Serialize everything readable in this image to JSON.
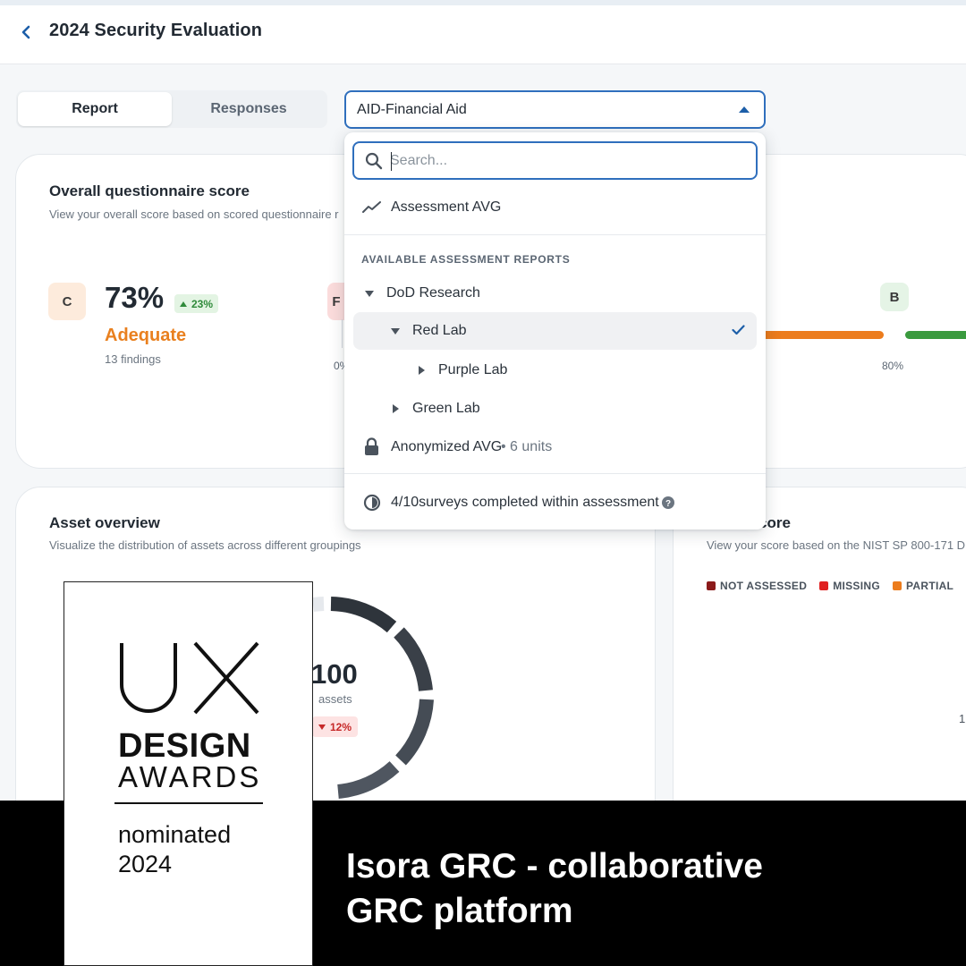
{
  "header": {
    "title": "2024 Security Evaluation",
    "back_icon": "chevron-left-icon"
  },
  "tabs": [
    {
      "label": "Report",
      "active": true
    },
    {
      "label": "Responses",
      "active": false
    }
  ],
  "report_select": {
    "value": "AID-Financial Aid"
  },
  "dropdown": {
    "search_placeholder": "Search...",
    "assessment_avg": "Assessment AVG",
    "section_heading": "AVAILABLE ASSESSMENT REPORTS",
    "tree": [
      {
        "label": "DoD Research",
        "expanded": true,
        "level": 0
      },
      {
        "label": "Red Lab",
        "expanded": true,
        "level": 1,
        "selected": true
      },
      {
        "label": "Purple Lab",
        "expanded": false,
        "level": 2
      },
      {
        "label": "Green Lab",
        "expanded": false,
        "level": 1
      }
    ],
    "anonymized_label": "Anonymized AVG",
    "anonymized_units": "• 6 units",
    "footer_text": "4/10surveys completed within assessment"
  },
  "score_card": {
    "title": "Overall questionnaire score",
    "subtitle": "View your overall score based on scored questionnaire r",
    "grade": "C",
    "percent": "73%",
    "delta": "23%",
    "rating": "Adequate",
    "findings": "13 findings",
    "scale_grade_left": "F",
    "scale_grade_right": "B",
    "axis_left": "0%",
    "axis_right": "80%"
  },
  "asset_card": {
    "title": "Asset overview",
    "subtitle": "Visualize the distribution of assets across different groupings",
    "count": "100",
    "count_label": "assets",
    "delta": "12%"
  },
  "nist_card": {
    "title_partial": "core",
    "subtitle": "View your score based on the NIST SP 800-171 D",
    "legend": [
      {
        "label": "NOT ASSESSED",
        "color": "#8b1a1a"
      },
      {
        "label": "MISSING",
        "color": "#e02020"
      },
      {
        "label": "PARTIAL",
        "color": "#ec7c1d"
      },
      {
        "label": "",
        "color": "#3a9a3e"
      }
    ],
    "donut_partial_number": "1"
  },
  "award": {
    "line1": "DESIGN",
    "line2": "AWARDS",
    "line3": "nominated",
    "line4": "2024",
    "logo_letters": "UX"
  },
  "banner": {
    "line1": "Isora GRC - collaborative",
    "line2": "GRC platform"
  },
  "colors": {
    "accent": "#2f6fbd",
    "rating_orange": "#e9801f",
    "up_green": "#2f8a3a",
    "down_red": "#c62828"
  }
}
